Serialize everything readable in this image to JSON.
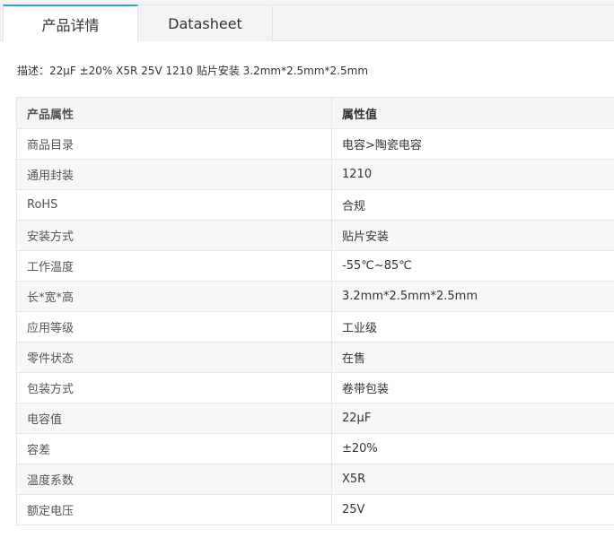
{
  "tabs": [
    {
      "label": "产品详情",
      "active": true
    },
    {
      "label": "Datasheet",
      "active": false
    }
  ],
  "description": "描述：22μF ±20% X5R 25V 1210 贴片安装 3.2mm*2.5mm*2.5mm",
  "table": {
    "headers": {
      "name": "产品属性",
      "value": "属性值"
    },
    "rows": [
      {
        "name": "商品目录",
        "value": "电容>陶瓷电容"
      },
      {
        "name": "通用封装",
        "value": "1210"
      },
      {
        "name": "RoHS",
        "value": "合规"
      },
      {
        "name": "安装方式",
        "value": "贴片安装"
      },
      {
        "name": "工作温度",
        "value": "-55℃~85℃"
      },
      {
        "name": "长*宽*高",
        "value": "3.2mm*2.5mm*2.5mm"
      },
      {
        "name": "应用等级",
        "value": "工业级"
      },
      {
        "name": "零件状态",
        "value": "在售"
      },
      {
        "name": "包装方式",
        "value": "卷带包装"
      },
      {
        "name": "电容值",
        "value": "22μF"
      },
      {
        "name": "容差",
        "value": "±20%"
      },
      {
        "name": "温度系数",
        "value": "X5R"
      },
      {
        "name": "额定电压",
        "value": "25V"
      }
    ]
  },
  "colors": {
    "accent": "#2aa6dd",
    "header_bg": "#f5f5f5",
    "border": "#e6e6e6"
  }
}
